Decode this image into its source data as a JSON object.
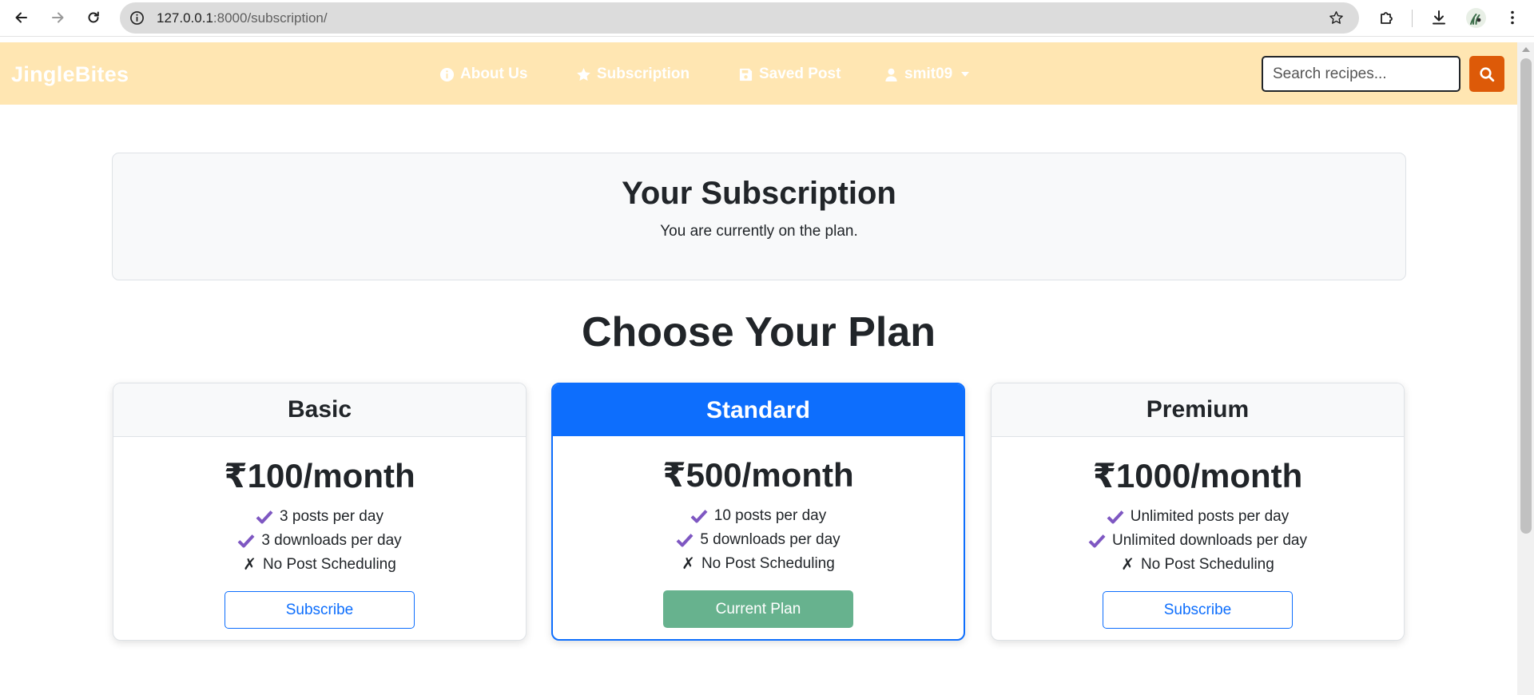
{
  "browser": {
    "url_host": "127.0.0.1",
    "url_path": ":8000/subscription/"
  },
  "navbar": {
    "brand": "JingleBites",
    "links": [
      {
        "label": "About Us",
        "icon": "info-circle-icon"
      },
      {
        "label": "Subscription",
        "icon": "star-icon"
      },
      {
        "label": "Saved Post",
        "icon": "floppy-disk-icon"
      },
      {
        "label": "smit09",
        "icon": "user-icon"
      }
    ],
    "search_placeholder": "Search recipes...",
    "colors": {
      "background": "#ffe6b2",
      "search_button": "#dd5a08"
    }
  },
  "subscription": {
    "title": "Your Subscription",
    "text": "You are currently on the plan."
  },
  "plans_title": "Choose Your Plan",
  "plans": [
    {
      "name": "Basic",
      "price": "₹100/month",
      "features": [
        "3 posts per day",
        "3 downloads per day",
        "No Post Scheduling"
      ],
      "button": "Subscribe"
    },
    {
      "name": "Standard",
      "price": "₹500/month",
      "features": [
        "10 posts per day",
        "5 downloads per day",
        "No Post Scheduling"
      ],
      "button": "Current Plan"
    },
    {
      "name": "Premium",
      "price": "₹1000/month",
      "features": [
        "Unlimited posts per day",
        "Unlimited downloads per day",
        "No Post Scheduling"
      ],
      "button": "Subscribe"
    }
  ],
  "colors": {
    "accent": "#0d6efd",
    "check": "#7e57c2",
    "current_plan": "#67b28e"
  }
}
